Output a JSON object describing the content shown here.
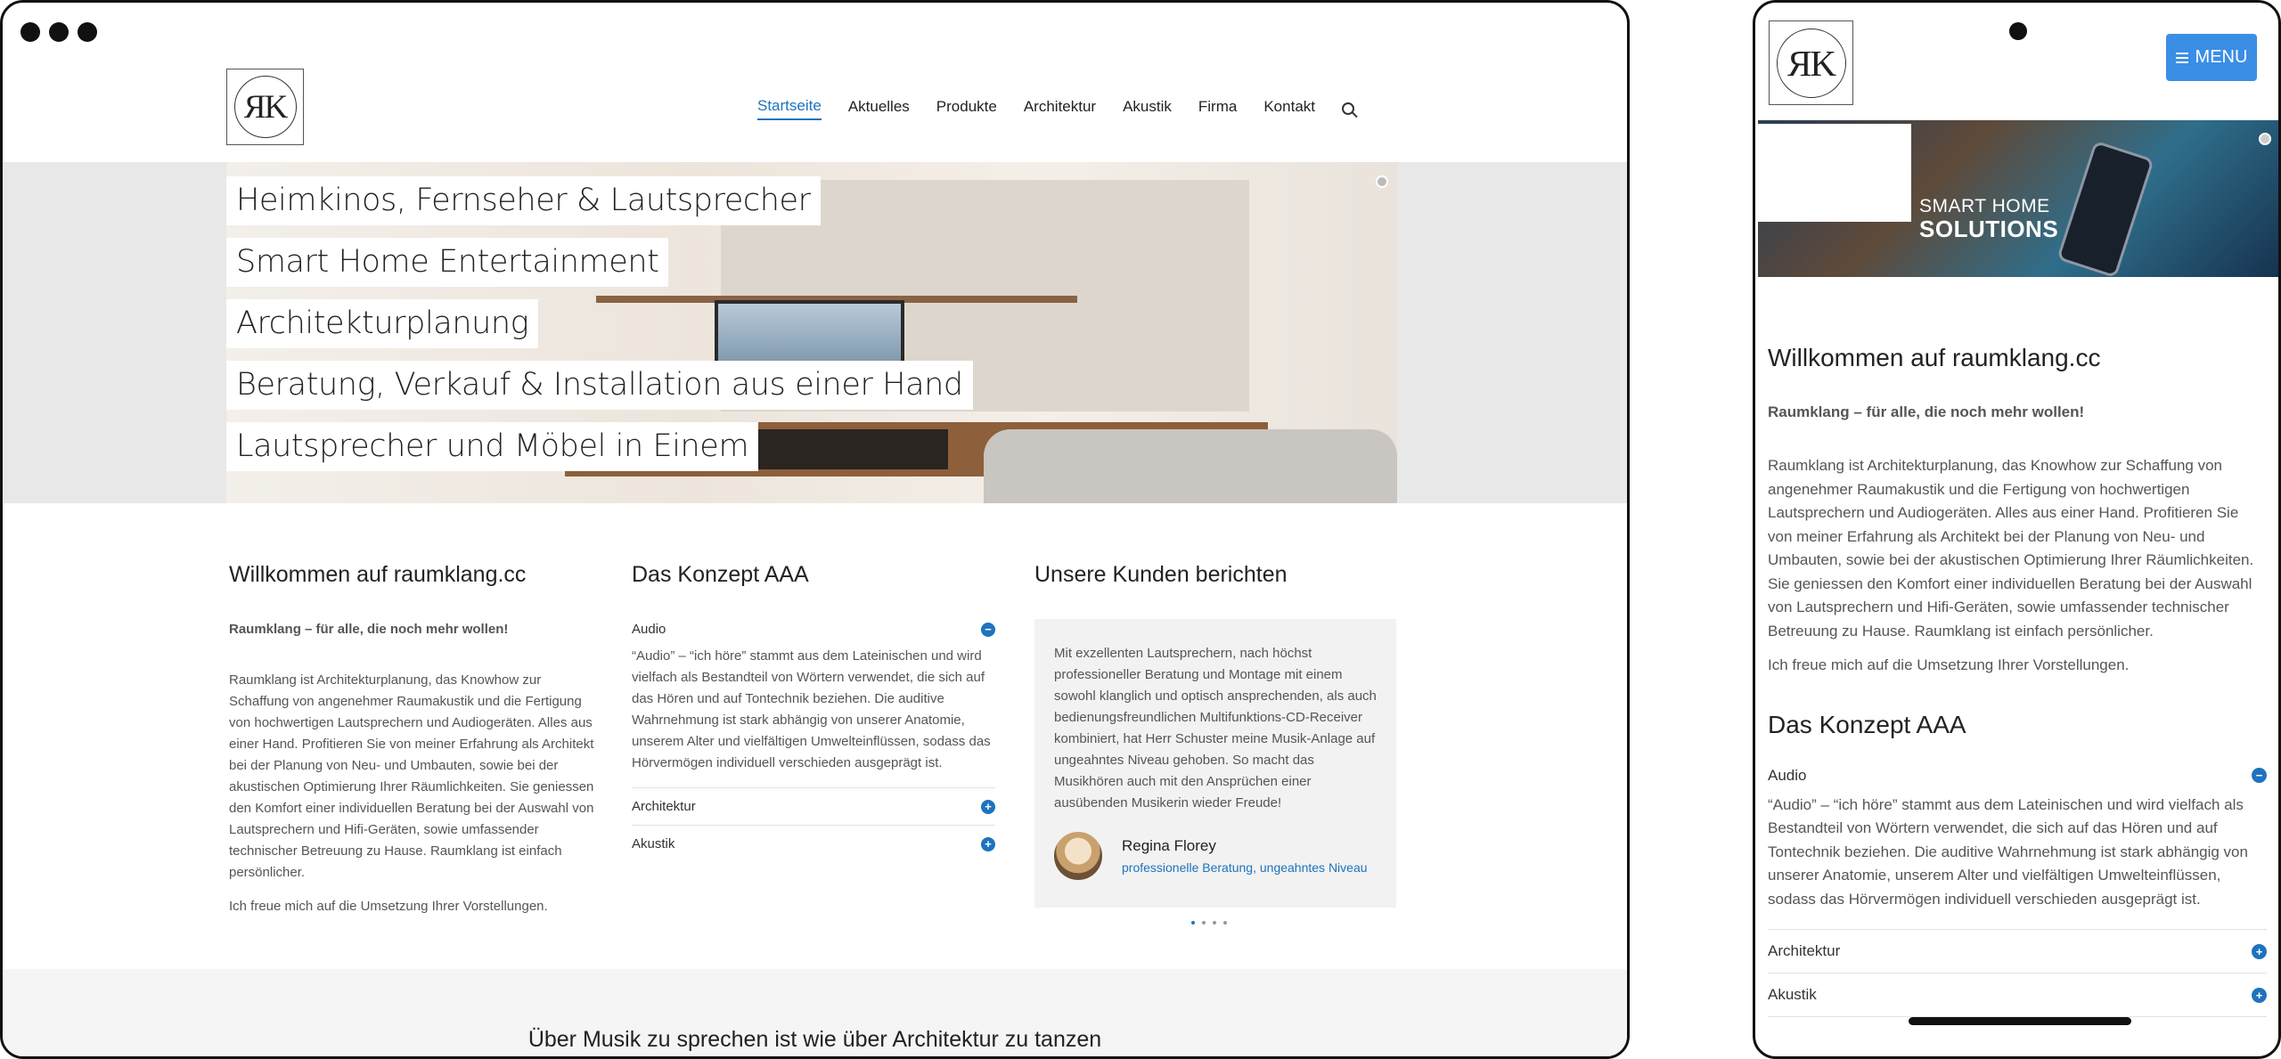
{
  "desktop": {
    "logo_text": "ЯK",
    "nav": [
      "Startseite",
      "Aktuelles",
      "Produkte",
      "Architektur",
      "Akustik",
      "Firma",
      "Kontakt"
    ],
    "hero_captions": [
      "Heimkinos, Fernseher & Lautsprecher",
      "Smart Home Entertainment",
      "Architekturplanung",
      "Beratung, Verkauf & Installation aus einer Hand",
      "Lautsprecher und Möbel in Einem"
    ],
    "welcome": {
      "title": "Willkommen auf raumklang.cc",
      "lead": "Raumklang – für alle, die noch mehr wollen!",
      "body": "Raumklang ist Architekturplanung, das Knowhow zur Schaffung von angenehmer Raumakustik und die Fertigung von hochwertigen Lautsprechern und Audiogeräten. Alles aus einer Hand. Profitieren Sie von meiner Erfahrung als Architekt bei der Planung von Neu- und Umbauten, sowie bei der akustischen Optimierung Ihrer Räumlichkeiten. Sie geniessen den Komfort einer individuellen Beratung bei der Auswahl von Lautsprechern und Hifi-Geräten, sowie umfassender technischer Betreuung zu Hause. Raumklang ist einfach persönlicher.",
      "closing": "Ich freue mich auf die Umsetzung Ihrer Vorstellungen."
    },
    "concept": {
      "title": "Das Konzept AAA",
      "open_label": "Audio",
      "open_body": "“Audio” – “ich höre” stammt aus dem Lateinischen und wird vielfach als Bestandteil von Wörtern verwendet, die sich auf das Hören und auf Tontechnik beziehen. Die auditive Wahrnehmung ist stark abhängig von unserer Anatomie, unserem Alter und vielfältigen Umwelteinflüssen, sodass das Hörvermögen individuell verschieden ausgeprägt ist.",
      "closed": [
        "Architektur",
        "Akustik"
      ]
    },
    "testimonials": {
      "title": "Unsere Kunden berichten",
      "quote": "Mit exzellenten Lautsprechern, nach höchst professioneller Beratung und Montage mit einem sowohl klanglich und optisch ansprechenden, als auch bedienungsfreundlichen Multifunktions-CD-Receiver kombiniert, hat Herr Schuster meine Musik-Anlage auf ungeahntes Niveau gehoben. So macht das Musikhören auch mit den Ansprüchen einer ausübenden Musikerin wieder Freude!",
      "author": "Regina Florey",
      "role": "professionelle Beratung, ungeahntes Niveau"
    },
    "footer_quote": "Über Musik zu sprechen ist wie über Architektur zu tanzen"
  },
  "mobile": {
    "logo_text": "ЯK",
    "menu_label": "MENU",
    "hero": {
      "line1": "SMART HOME",
      "line2": "SOLUTIONS"
    },
    "welcome_title": "Willkommen auf raumklang.cc",
    "lead": "Raumklang – für alle, die noch mehr wollen!",
    "body": "Raumklang ist Architekturplanung, das Knowhow zur Schaffung von angenehmer Raumakustik und die Fertigung von hochwertigen Lautsprechern und Audiogeräten. Alles aus einer Hand. Profitieren Sie von meiner Erfahrung als Architekt bei der Planung von Neu- und Umbauten, sowie bei der akustischen Optimierung Ihrer Räumlichkeiten. Sie geniessen den Komfort einer individuellen Beratung bei der Auswahl von Lautsprechern und Hifi-Geräten, sowie umfassender technischer Betreuung zu Hause. Raumklang ist einfach persönlicher.",
    "closing": "Ich freue mich auf die Umsetzung Ihrer Vorstellungen.",
    "concept_title": "Das Konzept AAA",
    "open_label": "Audio",
    "open_body": "“Audio” – “ich höre” stammt aus dem Lateinischen und wird vielfach als Bestandteil von Wörtern verwendet, die sich auf das Hören und auf Tontechnik beziehen. Die auditive Wahrnehmung ist stark abhängig von unserer Anatomie, unserem Alter und vielfältigen Umwelteinflüssen, sodass das Hörvermögen individuell verschieden ausgeprägt ist.",
    "closed": [
      "Architektur",
      "Akustik"
    ]
  },
  "colors": {
    "accent": "#1e73be",
    "menu_button": "#3a8ee6"
  }
}
